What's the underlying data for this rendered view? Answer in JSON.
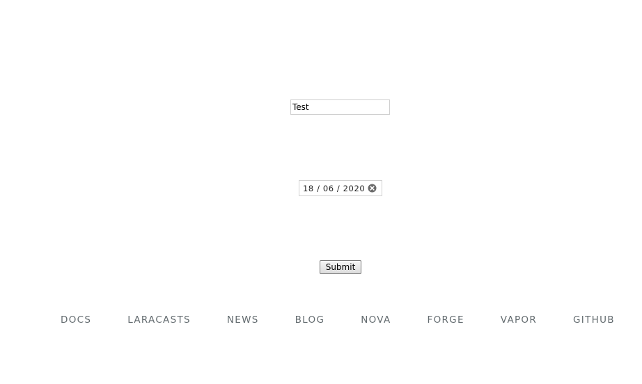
{
  "form": {
    "text_value": "Test",
    "date_value": "18 / 06 / 2020",
    "submit_label": "Submit"
  },
  "links": [
    {
      "label": "DOCS"
    },
    {
      "label": "LARACASTS"
    },
    {
      "label": "NEWS"
    },
    {
      "label": "BLOG"
    },
    {
      "label": "NOVA"
    },
    {
      "label": "FORGE"
    },
    {
      "label": "VAPOR"
    },
    {
      "label": "GITHUB"
    }
  ],
  "colors": {
    "link_text": "#636b6f",
    "clear_icon": "#6b6b6b"
  }
}
